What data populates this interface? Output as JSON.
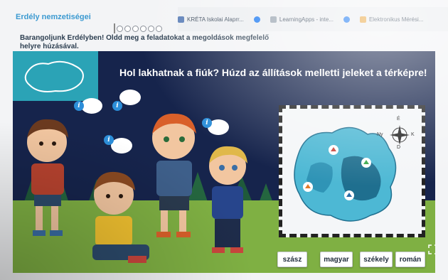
{
  "browser": {
    "bookmarks": [
      {
        "label": "KRÉTA Iskolai Alaprr...",
        "icon": "kreta-icon"
      },
      {
        "label": "",
        "icon": "facebook-icon"
      },
      {
        "label": "LearningApps - inte...",
        "icon": "learningapps-icon"
      },
      {
        "label": "",
        "icon": "facebook-icon"
      },
      {
        "label": "Elektronikus Mérési...",
        "icon": "emeresi-icon"
      }
    ]
  },
  "app": {
    "title": "Erdély nemzetiségei",
    "progress_total": 6,
    "progress_done": 0,
    "instruction": "Barangoljunk Erdélyben! Oldd meg a feladatokat a megoldások megfelelő helyre húzásával."
  },
  "game": {
    "question": "Hol lakhatnak a fiúk? Húzd az állítások melletti jeleket a térképre!",
    "compass": {
      "n": "É",
      "s": "D",
      "e": "K",
      "w": "Ny"
    },
    "answers": [
      "szász",
      "magyar",
      "székely",
      "román"
    ],
    "colors": {
      "sky": "#16244c",
      "ground": "#7fb043",
      "map_light": "#4db8d4",
      "map_dark": "#1f6f8f"
    }
  }
}
